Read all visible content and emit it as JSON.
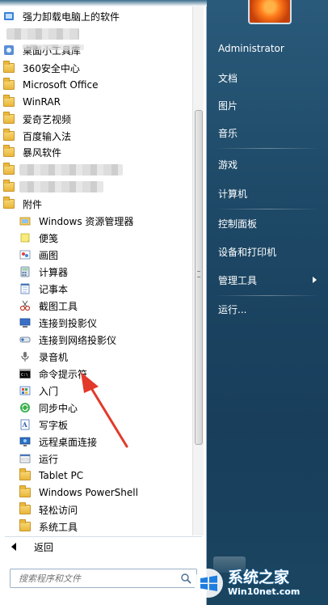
{
  "programs": {
    "items": [
      {
        "label": "强力卸载电脑上的软件",
        "icon": "uninstall-app-icon"
      },
      {
        "label": "",
        "icon": "blurred-icon"
      },
      {
        "label": "桌面小工具库",
        "icon": "gadgets-icon"
      },
      {
        "label": "360安全中心",
        "icon": "folder-icon"
      },
      {
        "label": "Microsoft Office",
        "icon": "folder-icon"
      },
      {
        "label": "WinRAR",
        "icon": "folder-icon"
      },
      {
        "label": "爱奇艺视频",
        "icon": "folder-icon"
      },
      {
        "label": "百度输入法",
        "icon": "folder-icon"
      },
      {
        "label": "暴风软件",
        "icon": "folder-icon"
      },
      {
        "label": "",
        "icon": "folder-icon"
      },
      {
        "label": "",
        "icon": "folder-icon"
      },
      {
        "label": "附件",
        "icon": "folder-icon"
      },
      {
        "label": "Windows 资源管理器",
        "icon": "explorer-icon"
      },
      {
        "label": "便笺",
        "icon": "sticky-notes-icon"
      },
      {
        "label": "画图",
        "icon": "paint-icon"
      },
      {
        "label": "计算器",
        "icon": "calculator-icon"
      },
      {
        "label": "记事本",
        "icon": "notepad-icon"
      },
      {
        "label": "截图工具",
        "icon": "snipping-tool-icon"
      },
      {
        "label": "连接到投影仪",
        "icon": "projector-icon"
      },
      {
        "label": "连接到网络投影仪",
        "icon": "network-projector-icon"
      },
      {
        "label": "录音机",
        "icon": "microphone-icon"
      },
      {
        "label": "命令提示符",
        "icon": "command-prompt-icon"
      },
      {
        "label": "入门",
        "icon": "getting-started-icon"
      },
      {
        "label": "同步中心",
        "icon": "sync-center-icon"
      },
      {
        "label": "写字板",
        "icon": "wordpad-icon"
      },
      {
        "label": "远程桌面连接",
        "icon": "remote-desktop-icon"
      },
      {
        "label": "运行",
        "icon": "run-icon"
      },
      {
        "label": "Tablet PC",
        "icon": "folder-icon"
      },
      {
        "label": "Windows PowerShell",
        "icon": "folder-icon"
      },
      {
        "label": "轻松访问",
        "icon": "folder-icon"
      },
      {
        "label": "系统工具",
        "icon": "folder-icon"
      }
    ],
    "back_label": "返回"
  },
  "search": {
    "placeholder": "搜索程序和文件"
  },
  "right_pane": {
    "items": [
      "Administrator",
      "文档",
      "图片",
      "音乐",
      "游戏",
      "计算机",
      "控制面板",
      "设备和打印机",
      "管理工具",
      "运行..."
    ]
  },
  "watermark": {
    "title": "系统之家",
    "url": "Win10net.com"
  },
  "colors": {
    "annotation_arrow": "#e23a2a",
    "right_pane_bg": "#1d4866",
    "left_pane_bg": "#ffffff"
  }
}
